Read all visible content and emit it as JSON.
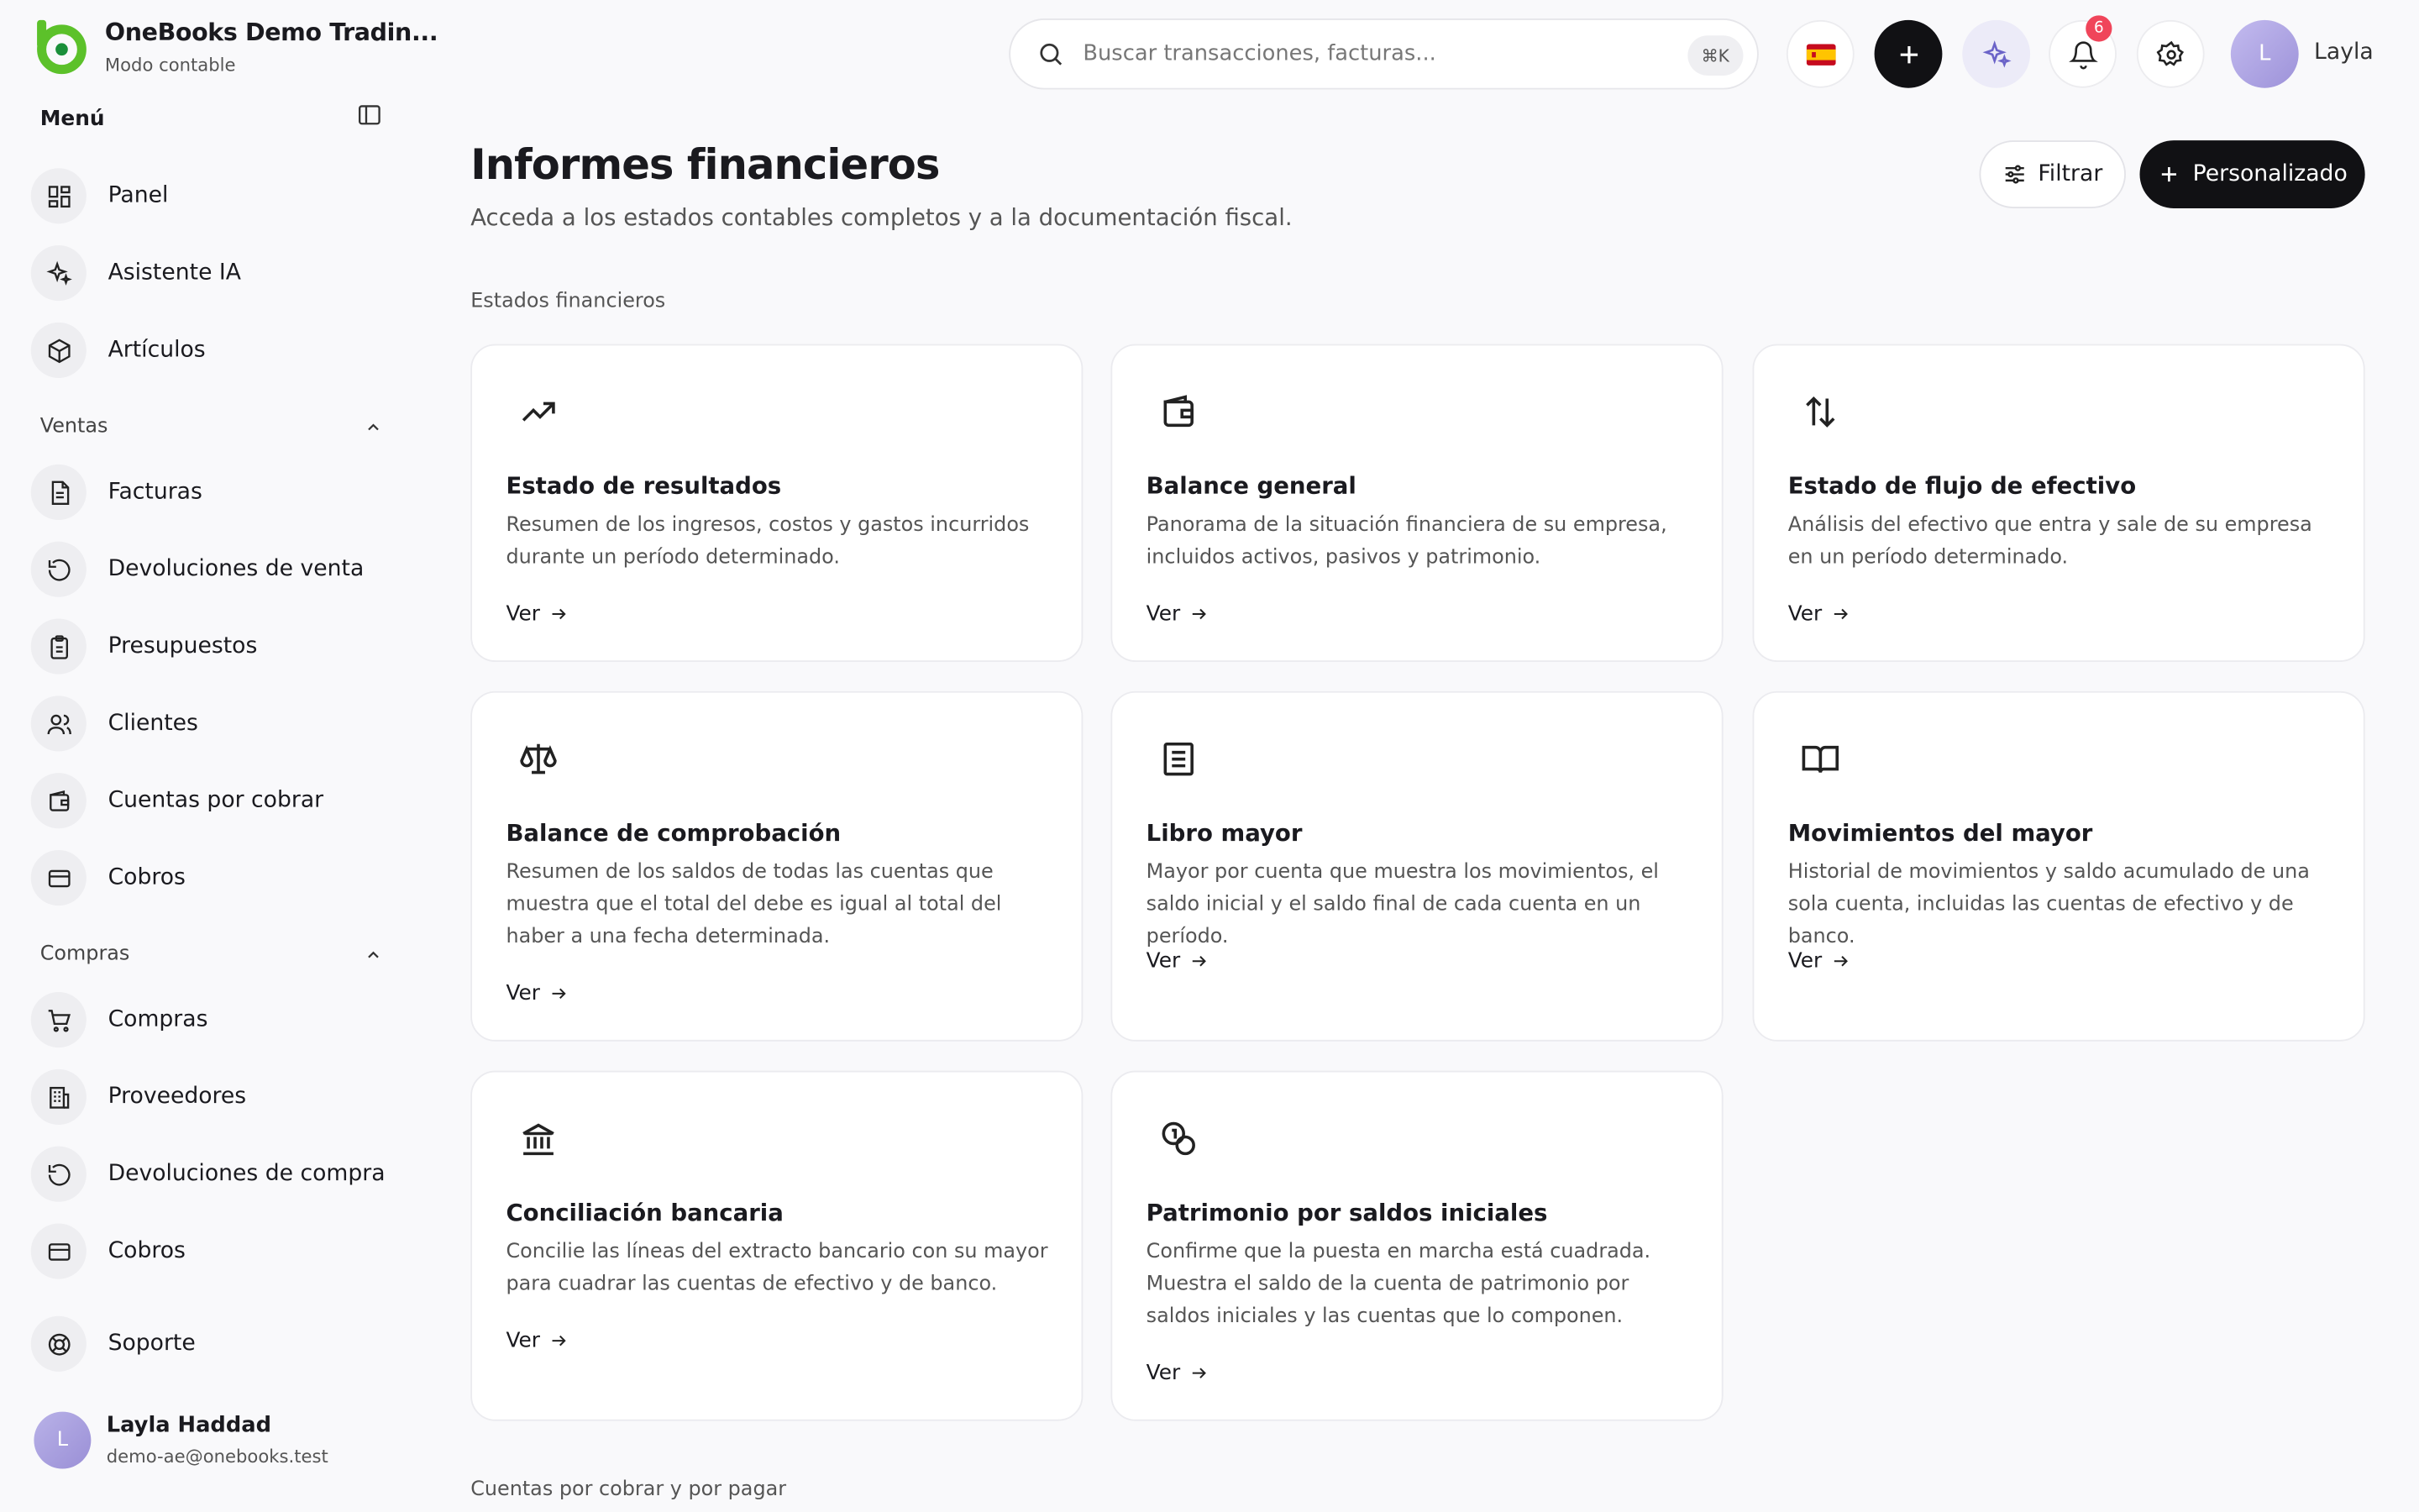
{
  "brand": {
    "name": "OneBooks Demo Tradin...",
    "mode": "Modo contable"
  },
  "sidebar": {
    "menu_title": "Menú",
    "top_items": [
      {
        "label": "Panel",
        "icon": "dashboard-icon"
      },
      {
        "label": "Asistente IA",
        "icon": "sparkles-icon"
      },
      {
        "label": "Artículos",
        "icon": "package-icon"
      }
    ],
    "groups": [
      {
        "title": "Ventas",
        "items": [
          {
            "label": "Facturas",
            "icon": "document-icon"
          },
          {
            "label": "Devoluciones de venta",
            "icon": "rotate-icon"
          },
          {
            "label": "Presupuestos",
            "icon": "clipboard-icon"
          },
          {
            "label": "Clientes",
            "icon": "users-icon"
          },
          {
            "label": "Cuentas por cobrar",
            "icon": "wallet-icon"
          },
          {
            "label": "Cobros",
            "icon": "card-icon"
          }
        ]
      },
      {
        "title": "Compras",
        "items": [
          {
            "label": "Compras",
            "icon": "cart-icon"
          },
          {
            "label": "Proveedores",
            "icon": "building-icon"
          },
          {
            "label": "Devoluciones de compra",
            "icon": "rotate-icon"
          },
          {
            "label": "Cobros",
            "icon": "card-icon"
          }
        ]
      }
    ],
    "support": "Soporte",
    "user": {
      "initial": "L",
      "name": "Layla Haddad",
      "email": "demo-ae@onebooks.test"
    }
  },
  "topbar": {
    "search_placeholder": "Buscar transacciones, facturas...",
    "shortcut": "⌘K",
    "notifications_count": "6",
    "user_initial": "L",
    "user_name": "Layla"
  },
  "main": {
    "title": "Informes financieros",
    "subtitle": "Acceda a los estados contables completos y a la documentación fiscal.",
    "filter_label": "Filtrar",
    "custom_label": "Personalizado",
    "section1": "Estados financieros",
    "section2": "Cuentas por cobrar y por pagar",
    "cards": [
      {
        "title": "Estado de resultados",
        "desc": "Resumen de los ingresos, costos y gastos incurridos durante un período determinado.",
        "link": "Ver",
        "icon": "trending-up-icon"
      },
      {
        "title": "Balance general",
        "desc": "Panorama de la situación financiera de su empresa, incluidos activos, pasivos y patrimonio.",
        "link": "Ver",
        "icon": "wallet-icon"
      },
      {
        "title": "Estado de flujo de efectivo",
        "desc": "Análisis del efectivo que entra y sale de su empresa en un período determinado.",
        "link": "Ver",
        "icon": "arrows-up-down-icon"
      },
      {
        "title": "Balance de comprobación",
        "desc": "Resumen de los saldos de todas las cuentas que muestra que el total del debe es igual al total del haber a una fecha determinada.",
        "link": "Ver",
        "icon": "scale-icon"
      },
      {
        "title": "Libro mayor",
        "desc": "Mayor por cuenta que muestra los movimientos, el saldo inicial y el saldo final de cada cuenta en un período.",
        "link": "Ver",
        "icon": "ledger-icon"
      },
      {
        "title": "Movimientos del mayor",
        "desc": "Historial de movimientos y saldo acumulado de una sola cuenta, incluidas las cuentas de efectivo y de banco.",
        "link": "Ver",
        "icon": "book-open-icon"
      },
      {
        "title": "Conciliación bancaria",
        "desc": "Concilie las líneas del extracto bancario con su mayor para cuadrar las cuentas de efectivo y de banco.",
        "link": "Ver",
        "icon": "bank-icon"
      },
      {
        "title": "Patrimonio por saldos iniciales",
        "desc": "Confirme que la puesta en marcha está cuadrada. Muestra el saldo de la cuenta de patrimonio por saldos iniciales y las cuentas que lo componen.",
        "link": "Ver",
        "icon": "coins-icon"
      }
    ]
  },
  "colors": {
    "accent": "#1a8f3a",
    "logo": "#5cc12a",
    "dark": "#111114",
    "badge": "#f0455a"
  }
}
